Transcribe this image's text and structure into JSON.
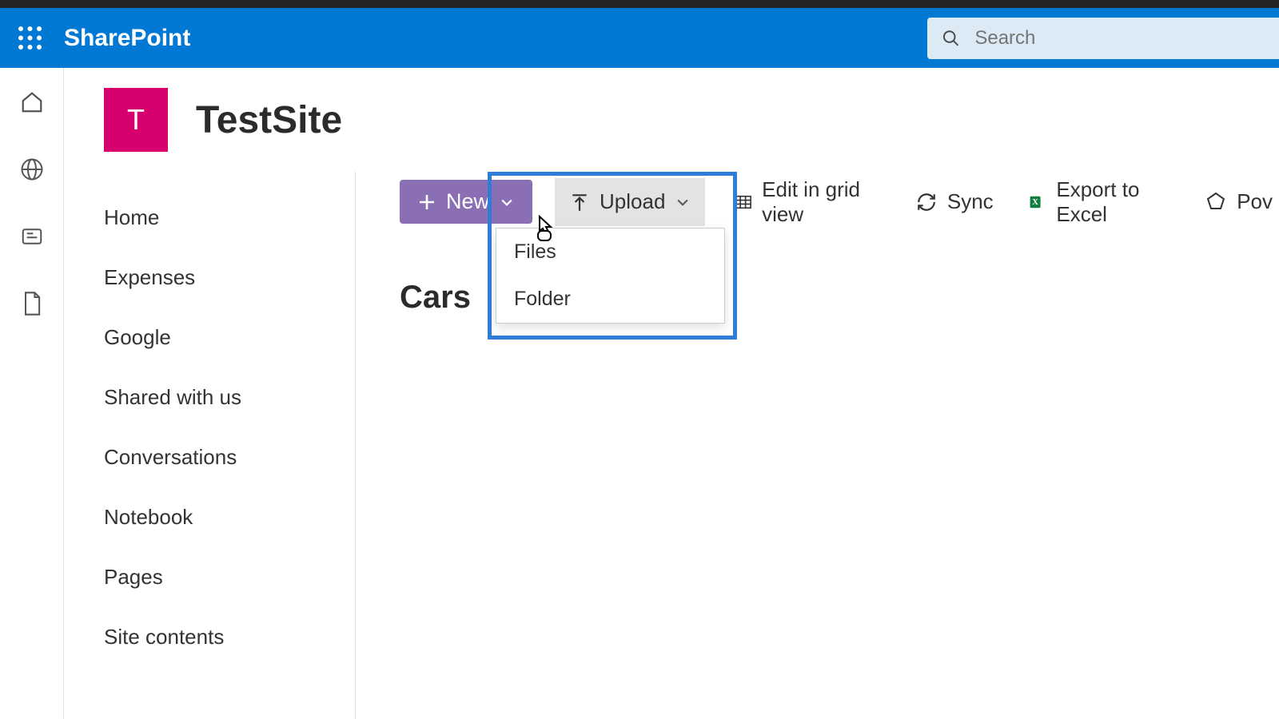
{
  "brand": "SharePoint",
  "search_placeholder": "Search",
  "site": {
    "logo_initial": "T",
    "title": "TestSite"
  },
  "nav": {
    "items": [
      {
        "label": "Home"
      },
      {
        "label": "Expenses"
      },
      {
        "label": "Google"
      },
      {
        "label": "Shared with us"
      },
      {
        "label": "Conversations"
      },
      {
        "label": "Notebook"
      },
      {
        "label": "Pages"
      },
      {
        "label": "Site contents"
      }
    ]
  },
  "commands": {
    "new": "New",
    "upload": "Upload",
    "edit_grid": "Edit in grid view",
    "sync": "Sync",
    "export_excel": "Export to Excel",
    "power_truncated": "Pov"
  },
  "upload_menu": {
    "files": "Files",
    "folder": "Folder"
  },
  "library": {
    "title": "Cars"
  }
}
